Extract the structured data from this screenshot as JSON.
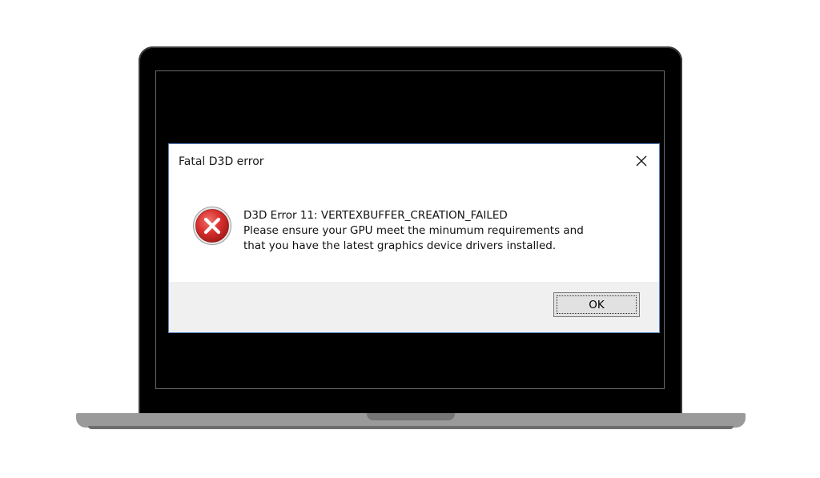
{
  "dialog": {
    "title": "Fatal D3D error",
    "icon": "error-icon",
    "message_lines": [
      "D3D Error 11: VERTEXBUFFER_CREATION_FAILED",
      "Please ensure your GPU meet the minumum requirements and",
      "that you have the latest graphics device drivers installed."
    ],
    "ok_label": "OK",
    "close_icon": "close-icon"
  },
  "colors": {
    "error_red": "#d9312f",
    "dialog_border": "#5b86c2",
    "footer_bg": "#f0f0f0",
    "laptop_body": "#9a9a9a"
  }
}
